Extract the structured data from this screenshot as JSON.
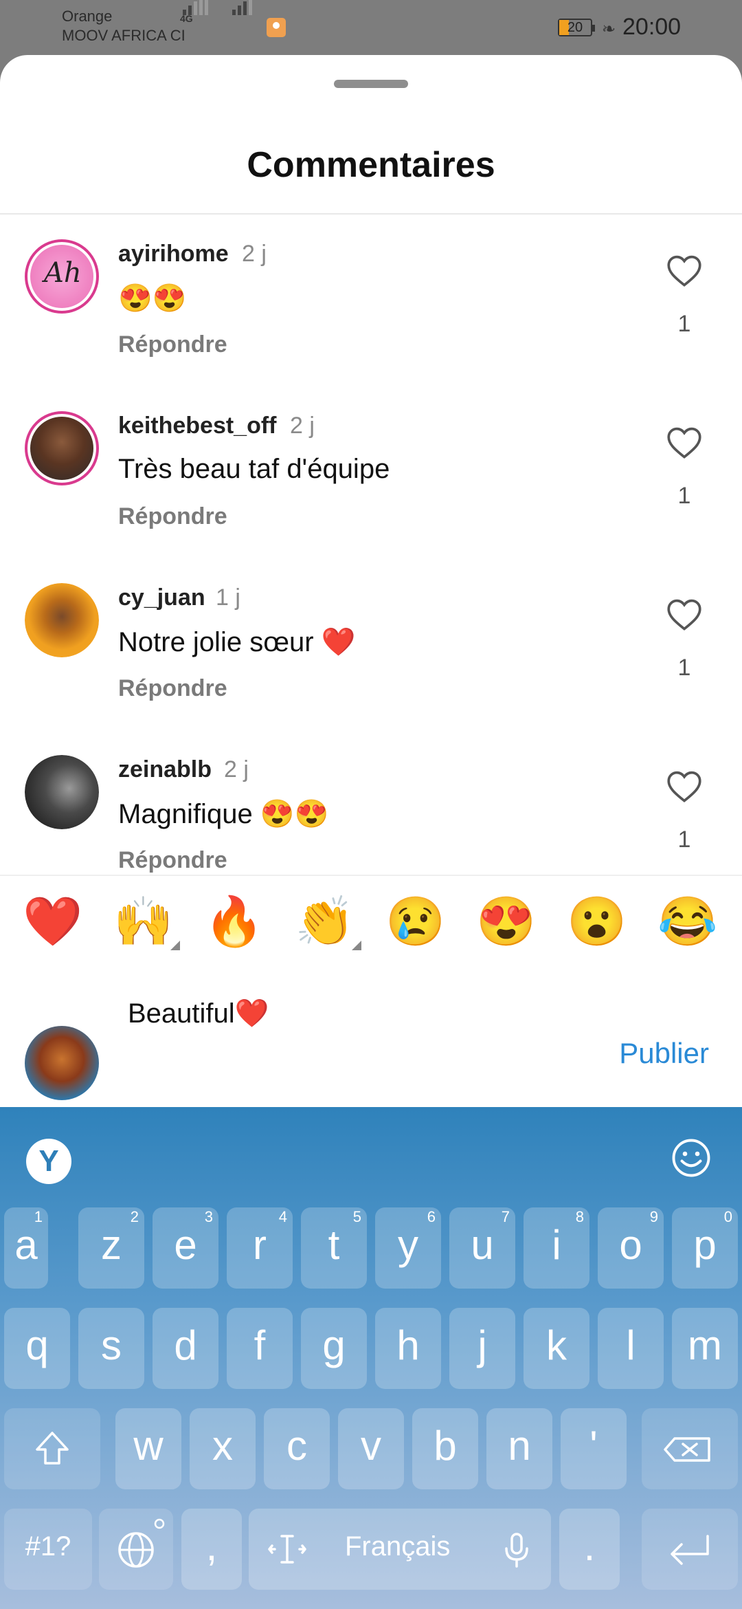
{
  "status_bar": {
    "carrier_line1": "Orange",
    "carrier_line2": "MOOV AFRICA CI",
    "network": "4G",
    "battery": "20",
    "time": "20:00"
  },
  "sheet": {
    "title": "Commentaires",
    "comments": [
      {
        "username": "ayirihome",
        "time": "2 j",
        "text": "😍😍",
        "reply": "Répondre",
        "likes": "1",
        "avatar": "avatar-ayirihome"
      },
      {
        "username": "keithebest_off",
        "time": "2 j",
        "text": "Très beau taf d'équipe",
        "reply": "Répondre",
        "likes": "1",
        "avatar": "avatar-keithebest"
      },
      {
        "username": "cy_juan",
        "time": "1 j",
        "text": "Notre jolie sœur ❤️",
        "reply": "Répondre",
        "likes": "1",
        "avatar": "avatar-cy-juan"
      },
      {
        "username": "zeinablb",
        "time": "2 j",
        "text": "Magnifique 😍😍",
        "reply": "Répondre",
        "likes": "1",
        "avatar": "avatar-zeinablb"
      }
    ]
  },
  "emoji_bar": [
    "❤️",
    "🙌",
    "🔥",
    "👏",
    "😢",
    "😍",
    "😮",
    "😂"
  ],
  "composer": {
    "value": "Beautiful❤️",
    "publish_label": "Publier"
  },
  "keyboard": {
    "row1": [
      {
        "k": "a",
        "n": "1"
      },
      {
        "k": "z",
        "n": "2"
      },
      {
        "k": "e",
        "n": "3"
      },
      {
        "k": "r",
        "n": "4"
      },
      {
        "k": "t",
        "n": "5"
      },
      {
        "k": "y",
        "n": "6"
      },
      {
        "k": "u",
        "n": "7"
      },
      {
        "k": "i",
        "n": "8"
      },
      {
        "k": "o",
        "n": "9"
      },
      {
        "k": "p",
        "n": "0"
      }
    ],
    "row2": [
      "q",
      "s",
      "d",
      "f",
      "g",
      "h",
      "j",
      "k",
      "l",
      "m"
    ],
    "row3": [
      "w",
      "x",
      "c",
      "v",
      "b",
      "n",
      "'"
    ],
    "symbols_label": "#1?",
    "comma": ",",
    "space_label": "Français",
    "period": ".",
    "logo": "Y"
  },
  "colors": {
    "accent": "#2a8ad6",
    "keyboard_top": "#2f82bb",
    "story_ring": "#d93a8e"
  }
}
